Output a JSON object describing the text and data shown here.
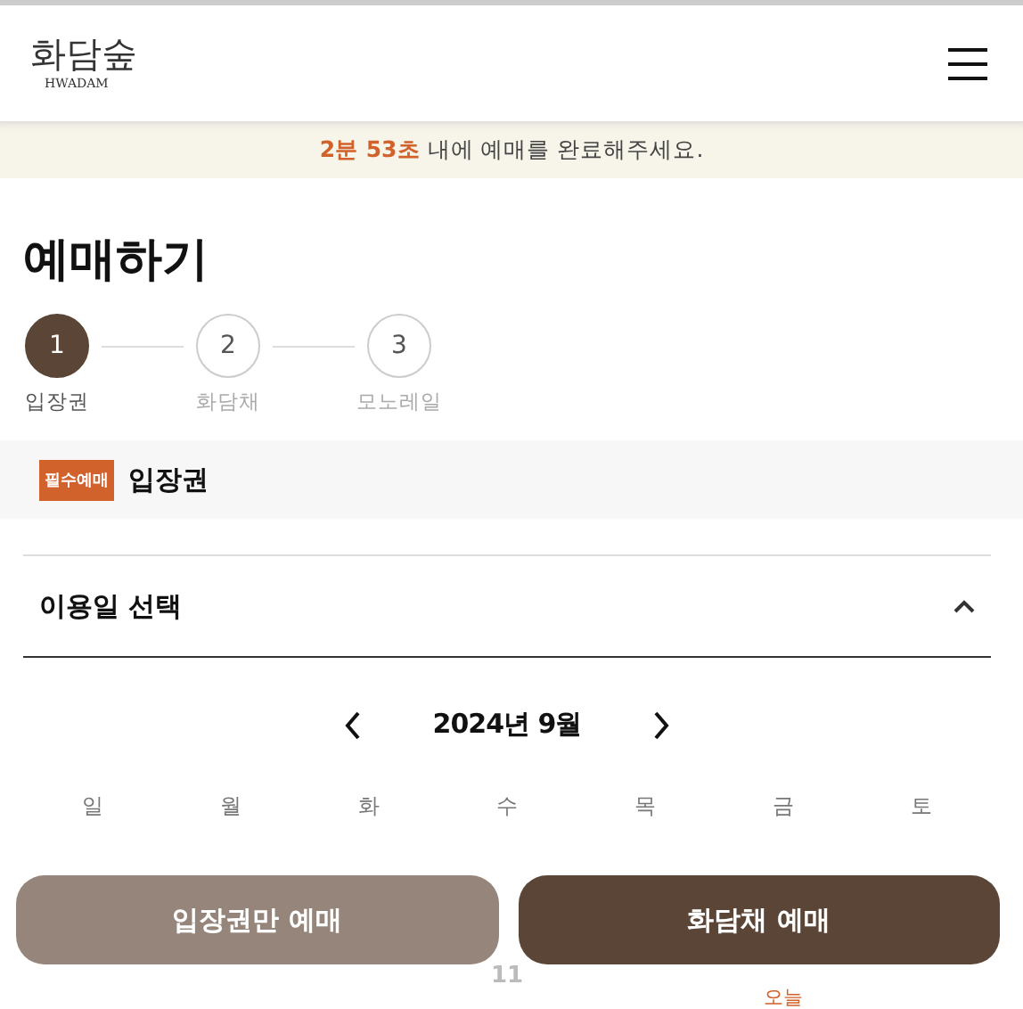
{
  "header": {
    "logo": "화담숲",
    "logo_sub": "HWADAM"
  },
  "timer_banner": {
    "time": "2분 53초",
    "message": "내에 예매를 완료해주세요."
  },
  "page_title": "예매하기",
  "steps": [
    {
      "number": "1",
      "label": "입장권",
      "selected": true
    },
    {
      "number": "2",
      "label": "화담채",
      "selected": false
    },
    {
      "number": "3",
      "label": "모노레일",
      "selected": false
    }
  ],
  "ticket_section": {
    "badge": "필수예매",
    "title": "입장권"
  },
  "date_panel": {
    "title": "이용일 선택",
    "expanded": true,
    "month": "2024년 9월",
    "weekdays": [
      "일",
      "월",
      "화",
      "수",
      "목",
      "금",
      "토"
    ],
    "visible_row": [
      {
        "kind": "blank"
      },
      {
        "kind": "blank"
      },
      {
        "kind": "blank"
      },
      {
        "kind": "date",
        "day": "11"
      },
      {
        "kind": "blank"
      },
      {
        "kind": "note",
        "note": "오늘"
      },
      {
        "kind": "blank"
      }
    ]
  },
  "buttons": [
    {
      "label": "입장권만 예매",
      "kind": "secondary"
    },
    {
      "label": "화담채 예매",
      "kind": "primary"
    }
  ]
}
